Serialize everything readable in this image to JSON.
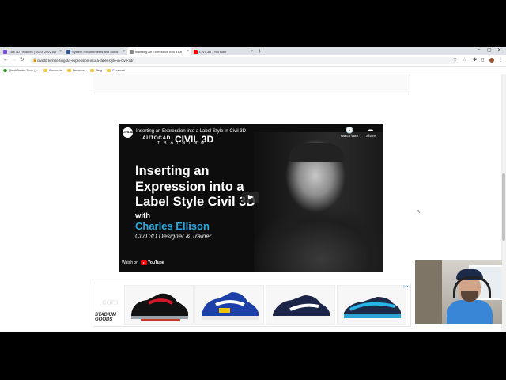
{
  "tabs": [
    {
      "title": "Civil 3D Features | 2023, 2022 Au",
      "favicon": "#7a4fd8",
      "active": false
    },
    {
      "title": "System Requirements and Softw",
      "favicon": "#2b5797",
      "active": false
    },
    {
      "title": "Inserting An Expression Into a La",
      "favicon": "#888888",
      "active": true
    },
    {
      "title": "CIVIL3D - YouTube",
      "favicon": "#ff0000",
      "active": false
    }
  ],
  "address": {
    "url": "civil3d.tv/inserting-an-expression-into-a-label-style-in-civil-3d/"
  },
  "bookmarks": [
    {
      "label": "QuickBooks Time (…",
      "icon": "qb"
    },
    {
      "label": "Concepts",
      "icon": "folder"
    },
    {
      "label": "Business",
      "icon": "folder"
    },
    {
      "label": "Blog",
      "icon": "folder"
    },
    {
      "label": "Personal",
      "icon": "folder"
    }
  ],
  "video": {
    "channel_logo": "CIVIL3D",
    "title": "Inserting an Expression into a Label Style in Civil 3D",
    "brand_line1": "AUTOCAD",
    "brand_line2": "CIVIL 3D",
    "brand_line3": "TRAINING",
    "watch_later": "Watch later",
    "share": "Share",
    "thumb_title": "Inserting an Expression into a Label Style Civil 3D",
    "with_label": "with",
    "presenter": "Charles Ellison",
    "presenter_role": "Civil 3D Designer & Trainer",
    "watch_on": "Watch on",
    "youtube": "YouTube"
  },
  "ad": {
    "logo_text": ".com",
    "brand": "STADIUM GOODS",
    "choices": "▷✕"
  },
  "colors": {
    "accent_blue": "#2aa6e0",
    "youtube_red": "#ff0000"
  }
}
